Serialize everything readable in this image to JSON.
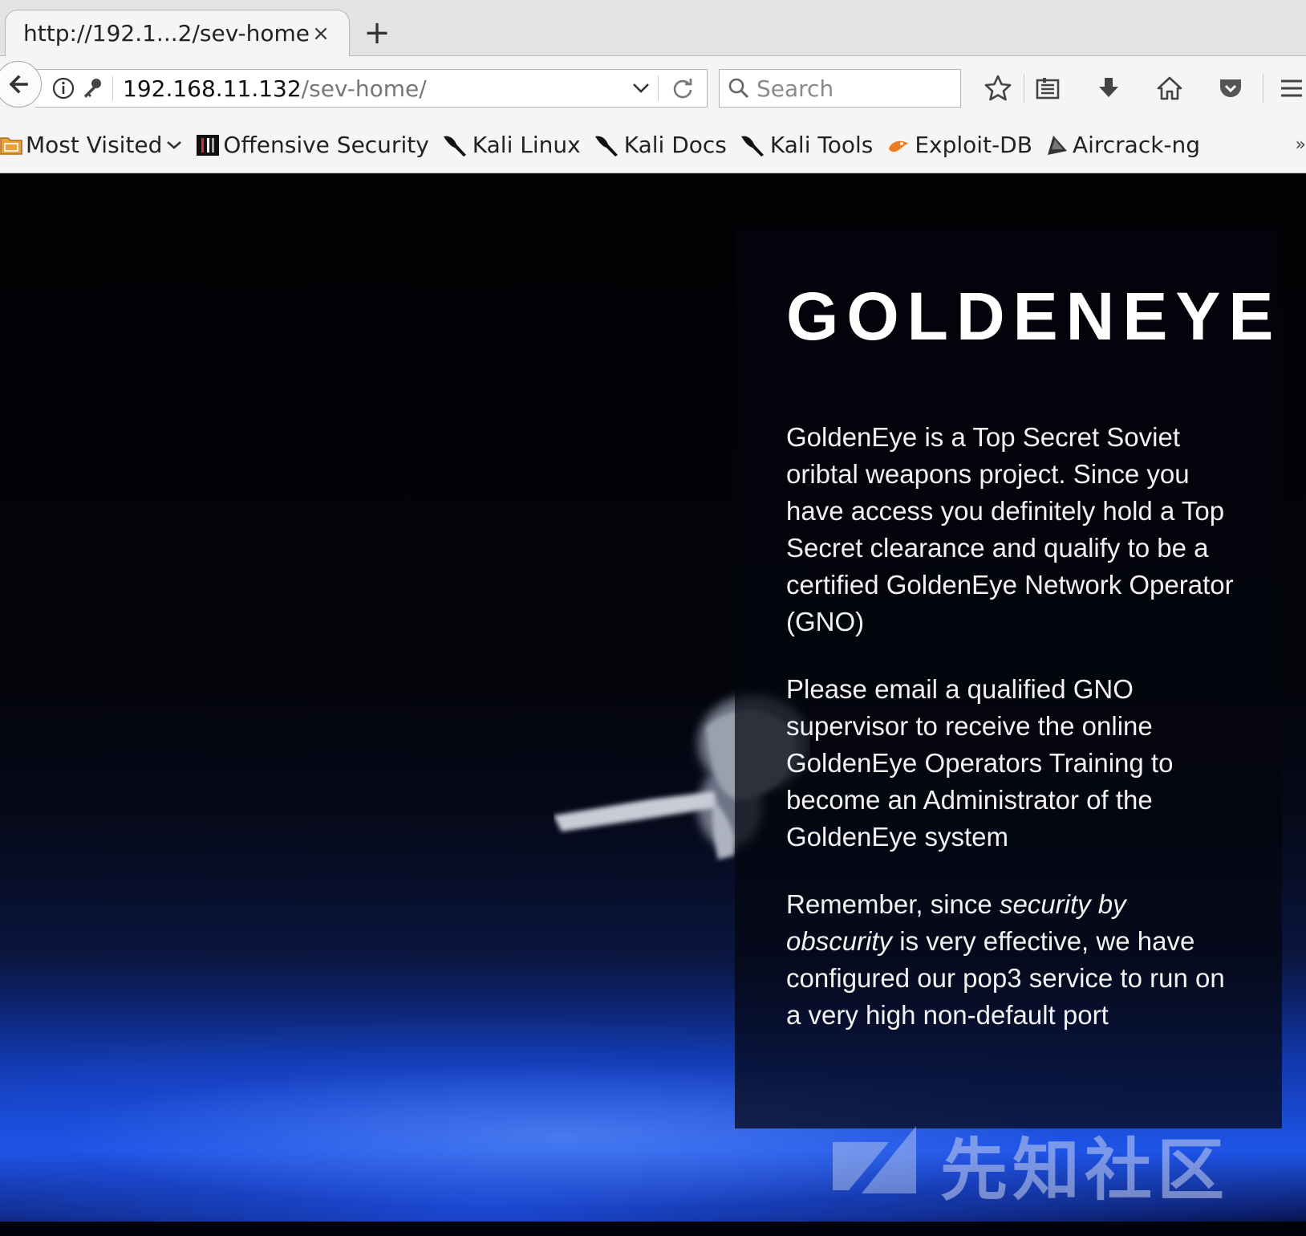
{
  "browser": {
    "tab": {
      "title": "http://192.1...2/sev-home/",
      "close": "×"
    },
    "new_tab": "+",
    "url": {
      "host": "192.168.11.132",
      "path": "/sev-home/"
    },
    "search": {
      "placeholder": "Search"
    },
    "toolbar_icons": [
      "star-icon",
      "reading-list-icon",
      "download-icon",
      "home-icon",
      "pocket-icon",
      "menu-icon"
    ],
    "bookmarks": [
      {
        "label": "Most Visited",
        "icon": "folder-icon"
      },
      {
        "label": "Offensive Security",
        "icon": "offsec-icon"
      },
      {
        "label": "Kali Linux",
        "icon": "kali-icon"
      },
      {
        "label": "Kali Docs",
        "icon": "kali-icon"
      },
      {
        "label": "Kali Tools",
        "icon": "kali-icon"
      },
      {
        "label": "Exploit-DB",
        "icon": "exploitdb-icon"
      },
      {
        "label": "Aircrack-ng",
        "icon": "aircrack-icon"
      }
    ],
    "bookmarks_overflow": "»"
  },
  "page": {
    "headline": "GOLDENEYE",
    "para1": "GoldenEye is a Top Secret Soviet oribtal weapons project. Since you have access you definitely hold a Top Secret clearance and qualify to be a certified GoldenEye Network Operator (GNO)",
    "para2": "Please email a qualified GNO supervisor to receive the online GoldenEye Operators Training to become an Administrator of the GoldenEye system",
    "para3": {
      "before": "Remember, since ",
      "emphasis": "security by obscurity",
      "after": " is very effective, we have configured our pop3 service to run on a very high non-default port"
    },
    "watermark": "先知社区"
  },
  "colors": {
    "page_background": "#000000",
    "earth_blue": "#1f55e8",
    "text": "#f2f2f2"
  }
}
